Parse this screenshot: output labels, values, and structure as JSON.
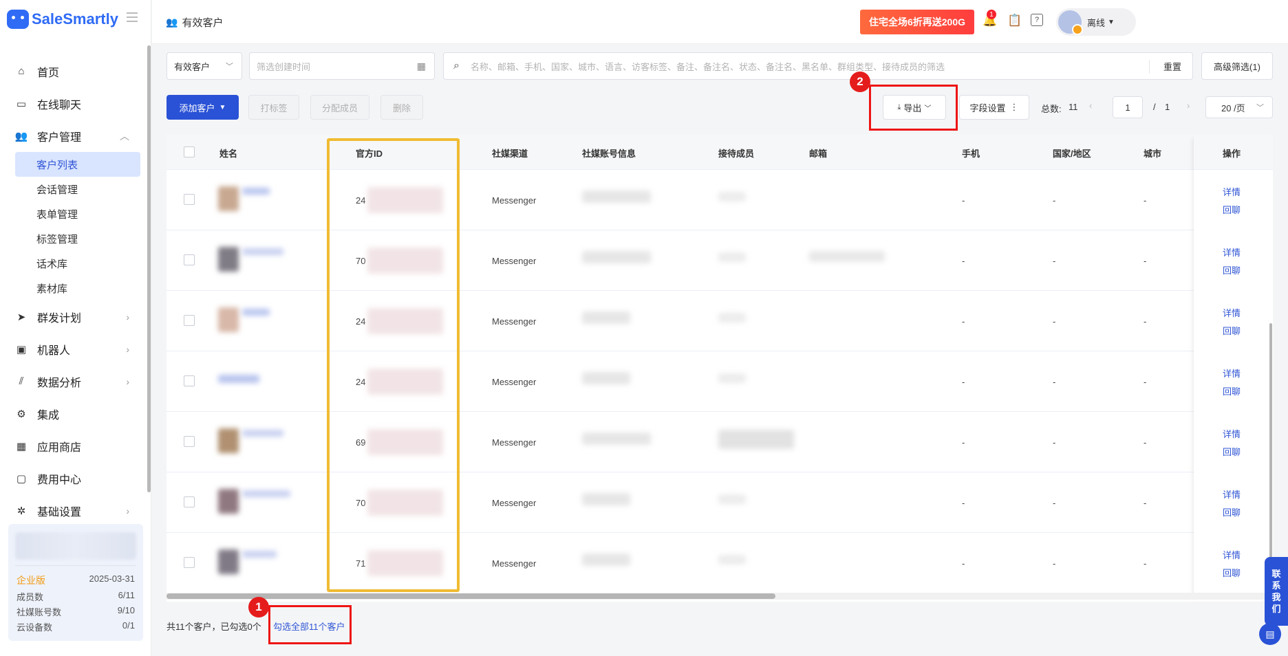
{
  "sidebar": {
    "logo_text": "SaleSmartly",
    "items": [
      {
        "label": "首页",
        "icon": "home-icon"
      },
      {
        "label": "在线聊天",
        "icon": "chat-icon"
      },
      {
        "label": "客户管理",
        "icon": "users-icon",
        "expanded": true
      },
      {
        "label": "群发计划",
        "icon": "send-icon"
      },
      {
        "label": "机器人",
        "icon": "robot-icon"
      },
      {
        "label": "数据分析",
        "icon": "chart-icon"
      },
      {
        "label": "集成",
        "icon": "integration-icon"
      },
      {
        "label": "应用商店",
        "icon": "apps-icon"
      },
      {
        "label": "费用中心",
        "icon": "wallet-icon"
      },
      {
        "label": "基础设置",
        "icon": "settings-icon"
      }
    ],
    "subitems": [
      "客户列表",
      "会话管理",
      "表单管理",
      "标签管理",
      "话术库",
      "素材库"
    ],
    "plan": {
      "edition": "企业版",
      "expiry": "2025-03-31",
      "rows": [
        {
          "label": "成员数",
          "value": "6/11"
        },
        {
          "label": "社媒账号数",
          "value": "9/10"
        },
        {
          "label": "云设备数",
          "value": "0/1"
        }
      ]
    }
  },
  "header": {
    "title": "有效客户",
    "promo_text": "住宅全场6折再送200G",
    "notification_count": "1",
    "status": "离线"
  },
  "filters": {
    "customer_type": "有效客户",
    "date_placeholder": "筛选创建时间",
    "search_placeholder": "名称、邮箱、手机、国家、城市、语言、访客标签、备注、备注名、状态、备注名、黑名单、群组类型、接待成员的筛选",
    "reset_label": "重置",
    "advanced_label": "高级筛选(1)"
  },
  "toolbar": {
    "add_label": "添加客户",
    "tag_label": "打标签",
    "assign_label": "分配成员",
    "delete_label": "删除",
    "export_label": "导出",
    "fields_label": "字段设置",
    "total_label": "总数:",
    "total_value": "11",
    "page_current": "1",
    "page_sep": "/",
    "page_total": "1",
    "page_size": "20 /页"
  },
  "table": {
    "headers": [
      "姓名",
      "官方ID",
      "社媒渠道",
      "社媒账号信息",
      "接待成员",
      "邮箱",
      "手机",
      "国家/地区",
      "城市",
      "操作"
    ],
    "rows": [
      {
        "id_prefix": "24",
        "channel": "Messenger",
        "phone": "-",
        "country": "-",
        "city": "-"
      },
      {
        "id_prefix": "70",
        "channel": "Messenger",
        "phone": "-",
        "country": "-",
        "city": "-"
      },
      {
        "id_prefix": "24",
        "channel": "Messenger",
        "phone": "-",
        "country": "-",
        "city": "-"
      },
      {
        "id_prefix": "24",
        "channel": "Messenger",
        "phone": "-",
        "country": "-",
        "city": "-"
      },
      {
        "id_prefix": "69",
        "channel": "Messenger",
        "phone": "-",
        "country": "-",
        "city": "-"
      },
      {
        "id_prefix": "70",
        "channel": "Messenger",
        "phone": "-",
        "country": "-",
        "city": "-"
      },
      {
        "id_prefix": "71",
        "channel": "Messenger",
        "phone": "-",
        "country": "-",
        "city": "-"
      }
    ],
    "action_detail": "详情",
    "action_reply": "回聊"
  },
  "footer": {
    "summary": "共11个客户，已勾选0个",
    "select_all": "勾选全部11个客户"
  },
  "annotations": {
    "badge1": "1",
    "badge2": "2"
  },
  "contact": {
    "label_chars": [
      "联",
      "系",
      "我",
      "们"
    ]
  },
  "colors": {
    "accent": "#2a52d6",
    "highlight_yellow": "#f0bb32",
    "annotation_red": "#ee1414"
  }
}
